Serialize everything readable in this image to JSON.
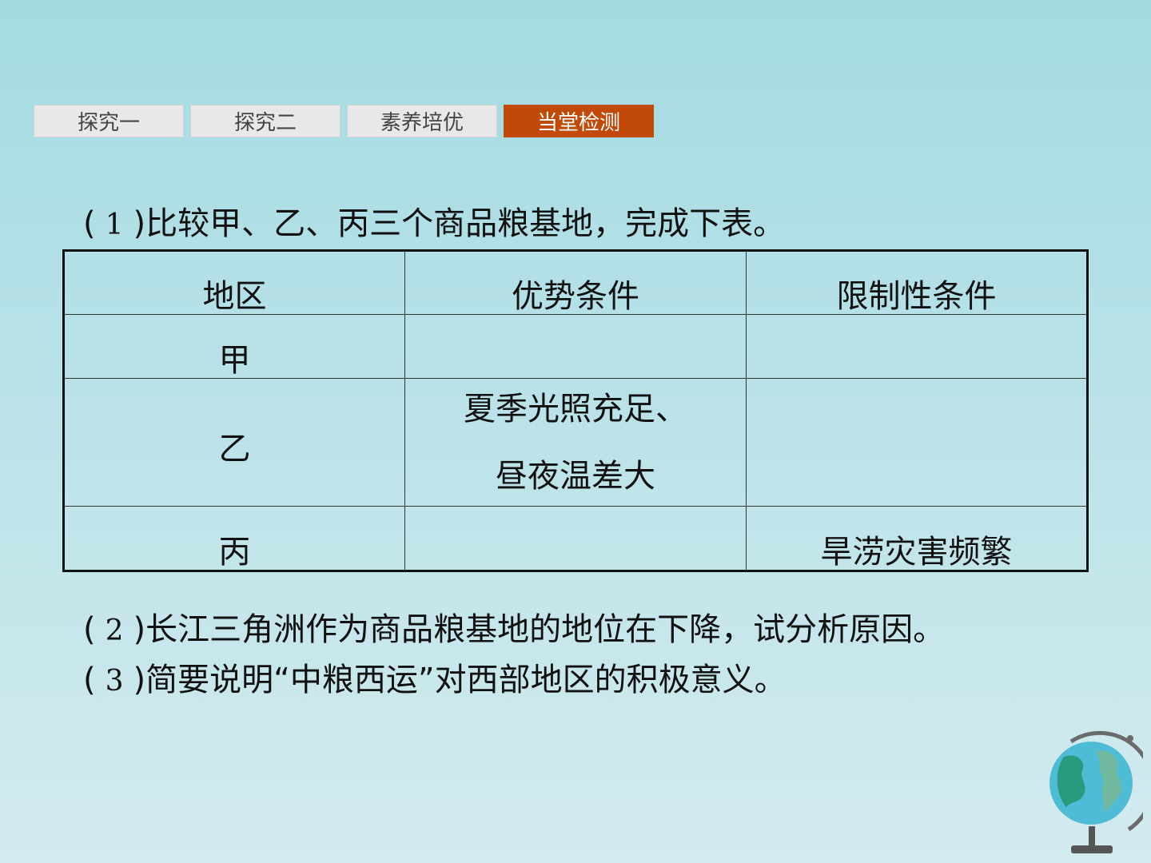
{
  "nav": {
    "tabs": [
      {
        "label": "探究一",
        "active": false
      },
      {
        "label": "探究二",
        "active": false
      },
      {
        "label": "素养培优",
        "active": false
      },
      {
        "label": "当堂检测",
        "active": true
      }
    ],
    "active_color": "#c14a08"
  },
  "q1": {
    "open": "(",
    "num": "1",
    "close": ")",
    "text": "比较甲、乙、丙三个商品粮基地，完成下表。"
  },
  "table": {
    "headers": [
      "地区",
      "优势条件",
      "限制性条件"
    ],
    "rows": [
      {
        "region": "甲",
        "advantage": [],
        "limit": ""
      },
      {
        "region": "乙",
        "advantage": [
          "夏季光照充足、",
          "昼夜温差大"
        ],
        "limit": ""
      },
      {
        "region": "丙",
        "advantage": [],
        "limit": "旱涝灾害频繁"
      }
    ]
  },
  "q2": {
    "open": "(",
    "num": "2",
    "close": ")",
    "text": "长江三角洲作为商品粮基地的地位在下降，试分析原因。"
  },
  "q3": {
    "open": "(",
    "num": "3",
    "close": ")",
    "text": "简要说明“中粮西运”对西部地区的积极意义。"
  },
  "decor": {
    "icon": "globe-icon"
  }
}
